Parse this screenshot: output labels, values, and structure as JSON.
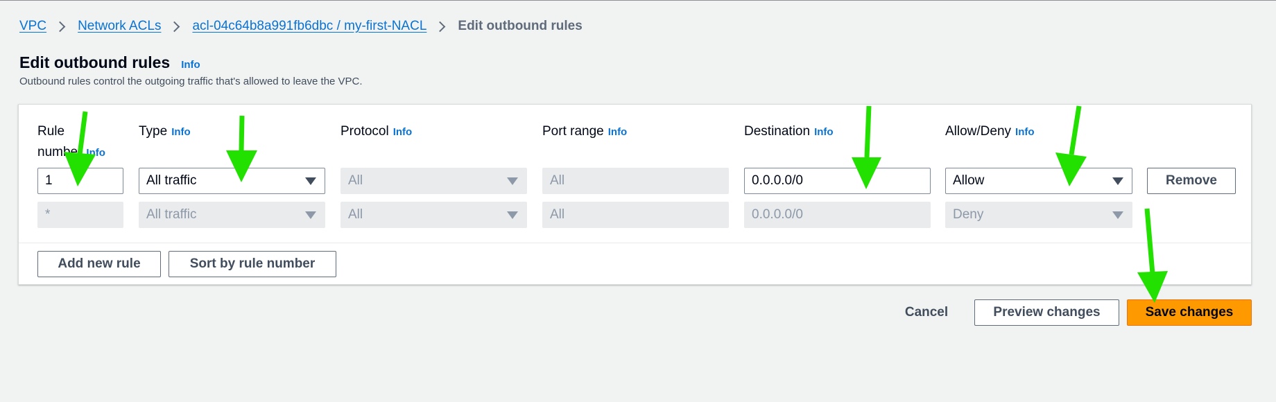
{
  "breadcrumb": {
    "items": [
      "VPC",
      "Network ACLs",
      "acl-04c64b8a991fb6dbc / my-first-NACL"
    ],
    "current": "Edit outbound rules"
  },
  "header": {
    "title": "Edit outbound rules",
    "info": "Info",
    "description": "Outbound rules control the outgoing traffic that's allowed to leave the VPC."
  },
  "table": {
    "columns": [
      {
        "label_line1": "Rule",
        "label_line2": "number",
        "info": "Info"
      },
      {
        "label": "Type",
        "info": "Info"
      },
      {
        "label": "Protocol",
        "info": "Info"
      },
      {
        "label": "Port range",
        "info": "Info"
      },
      {
        "label": "Destination",
        "info": "Info"
      },
      {
        "label": "Allow/Deny",
        "info": "Info"
      }
    ],
    "rows": [
      {
        "rule_number": "1",
        "type": "All traffic",
        "protocol": "All",
        "port_range": "All",
        "destination": "0.0.0.0/0",
        "action": "Allow",
        "remove_label": "Remove"
      },
      {
        "rule_number": "*",
        "type": "All traffic",
        "protocol": "All",
        "port_range": "All",
        "destination": "0.0.0.0/0",
        "action": "Deny"
      }
    ],
    "add_rule_label": "Add new rule",
    "sort_label": "Sort by rule number"
  },
  "footer": {
    "cancel_label": "Cancel",
    "preview_label": "Preview changes",
    "save_label": "Save changes"
  },
  "colors": {
    "link": "#0972d3",
    "primary_button": "#ff9900",
    "annotation_arrow": "#22e000"
  }
}
